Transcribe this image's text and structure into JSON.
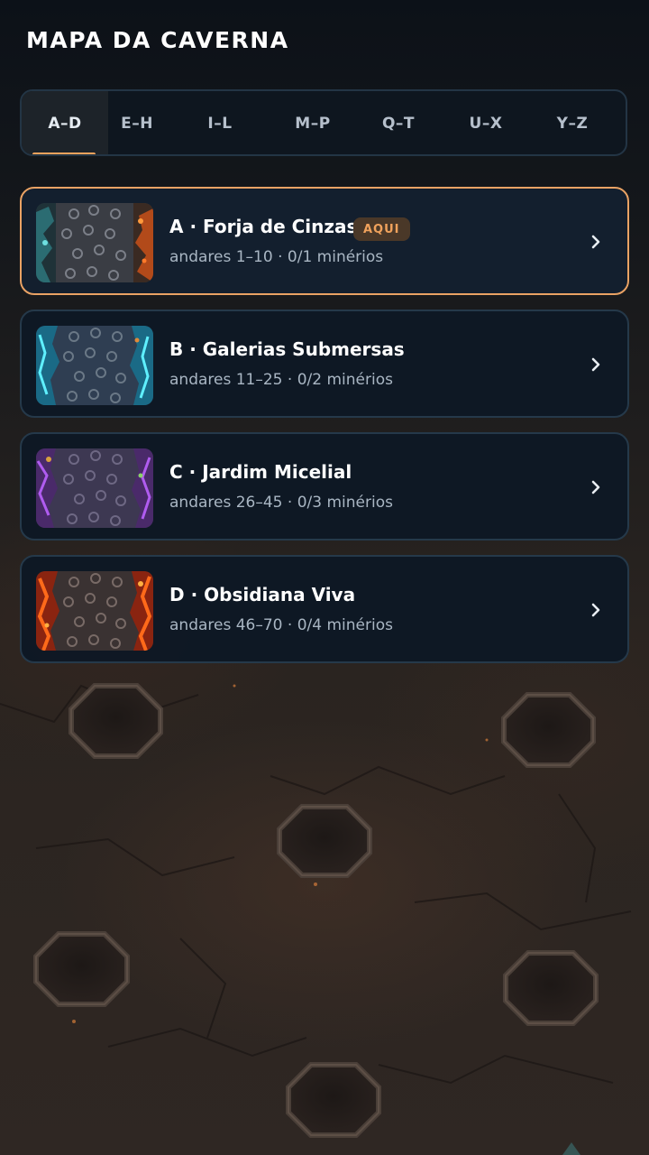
{
  "title": "MAPA DA CAVERNA",
  "tabs": [
    {
      "label": "A–D",
      "active": true
    },
    {
      "label": "E–H",
      "active": false
    },
    {
      "label": "I–L",
      "active": false
    },
    {
      "label": "M–P",
      "active": false
    },
    {
      "label": "Q–T",
      "active": false
    },
    {
      "label": "U–X",
      "active": false
    },
    {
      "label": "Y–Z",
      "active": false
    }
  ],
  "accent_color": "#f0a25c",
  "regions": [
    {
      "title": "A · Forja de Cinzas",
      "badge": "AQUI",
      "subtitle": "andares 1–10 · 0/1 minérios",
      "current": true,
      "theme": "ember-teal",
      "icon": "chevron-right-icon"
    },
    {
      "title": "B · Galerias Submersas",
      "badge": "",
      "subtitle": "andares 11–25 · 0/2 minérios",
      "current": false,
      "theme": "water-blue",
      "icon": "chevron-right-icon"
    },
    {
      "title": "C · Jardim Micelial",
      "badge": "",
      "subtitle": "andares 26–45 · 0/3 minérios",
      "current": false,
      "theme": "fungal-purple",
      "icon": "chevron-right-icon"
    },
    {
      "title": "D · Obsidiana Viva",
      "badge": "",
      "subtitle": "andares 46–70 · 0/4 minérios",
      "current": false,
      "theme": "lava-red",
      "icon": "chevron-right-icon"
    }
  ]
}
